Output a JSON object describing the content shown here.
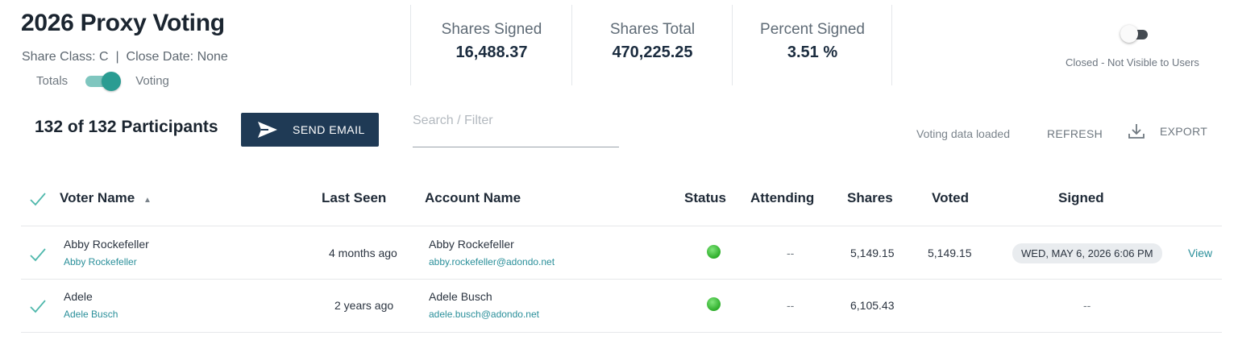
{
  "header": {
    "title": "2026 Proxy Voting",
    "subline": "Share Class: C  |  Close Date: None",
    "toggle_left": "Totals",
    "toggle_right": "Voting"
  },
  "stats": [
    {
      "label": "Shares Signed",
      "value": "16,488.37"
    },
    {
      "label": "Shares Total",
      "value": "470,225.25"
    },
    {
      "label": "Percent Signed",
      "value": "3.51 %"
    }
  ],
  "visibility": {
    "label": "Closed - Not Visible to Users",
    "on": false
  },
  "toolbar": {
    "participants": "132 of 132 Participants",
    "send_email": "SEND EMAIL",
    "search_placeholder": "Search / Filter",
    "status": "Voting data loaded",
    "refresh": "REFRESH",
    "export": "EXPORT"
  },
  "table": {
    "columns": {
      "voter_name": "Voter Name",
      "last_seen": "Last Seen",
      "account_name": "Account Name",
      "status": "Status",
      "attending": "Attending",
      "shares": "Shares",
      "voted": "Voted",
      "signed": "Signed"
    },
    "rows": [
      {
        "voter": "Abby Rockefeller",
        "voter_sub": "Abby Rockefeller",
        "last_seen": "4 months ago",
        "account": "Abby Rockefeller",
        "account_email": "abby.rockefeller@adondo.net",
        "attending": "--",
        "shares": "5,149.15",
        "voted": "5,149.15",
        "signed": "WED, MAY 6, 2026 6:06 PM",
        "view": "View"
      },
      {
        "voter": "Adele",
        "voter_sub": "Adele Busch",
        "last_seen": "2 years ago",
        "account": "Adele Busch",
        "account_email": "adele.busch@adondo.net",
        "attending": "--",
        "shares": "6,105.43",
        "voted": "",
        "signed": "--"
      }
    ]
  },
  "colors": {
    "accent": "#2a9c92",
    "button": "#1f3a55",
    "status_ok": "#2dad2a",
    "link": "#2a8f9a"
  }
}
